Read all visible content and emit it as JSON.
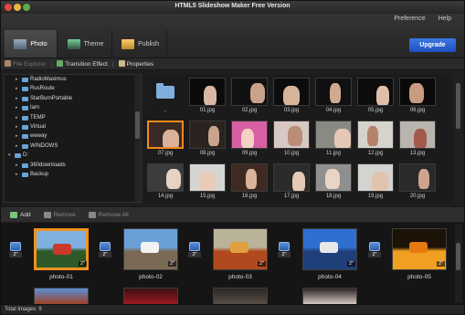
{
  "window": {
    "title": "HTML5 Slideshow Maker Free Version"
  },
  "menu": {
    "preference": "Preference",
    "help": "Help"
  },
  "tabs": [
    {
      "label": "Photo",
      "icon": "photo-tab-icon",
      "active": true
    },
    {
      "label": "Theme",
      "icon": "theme-tab-icon",
      "active": false
    },
    {
      "label": "Publish",
      "icon": "publish-tab-icon",
      "active": false
    }
  ],
  "upgrade_label": "Upgrade",
  "toolbar": {
    "file_explorer": "File Explorer",
    "transition_effect": "Transition Effect",
    "properties": "Properties",
    "separator": "|"
  },
  "tree": [
    {
      "label": "RadioMaximus",
      "level": 2,
      "expanded": false
    },
    {
      "label": "RusRoute",
      "level": 2,
      "expanded": false
    },
    {
      "label": "StarBurnPortable",
      "level": 2,
      "expanded": false
    },
    {
      "label": "tam",
      "level": 2,
      "expanded": false
    },
    {
      "label": "TEMP",
      "level": 2,
      "expanded": false
    },
    {
      "label": "Virtual",
      "level": 2,
      "expanded": false
    },
    {
      "label": "weway",
      "level": 2,
      "expanded": false
    },
    {
      "label": "WINDOWS",
      "level": 2,
      "expanded": false
    },
    {
      "label": "D:",
      "level": 1,
      "expanded": true
    },
    {
      "label": "360downloads",
      "level": 2,
      "expanded": false
    },
    {
      "label": "Backup",
      "level": 2,
      "expanded": false
    }
  ],
  "grid": {
    "items": [
      {
        "label": "..",
        "kind": "folder"
      },
      {
        "label": "01.jpg",
        "kind": "image",
        "bg": "#0b0b0b",
        "fg": "#d9b8a3"
      },
      {
        "label": "02.jpg",
        "kind": "image",
        "bg": "#111111",
        "fg": "#caa28a"
      },
      {
        "label": "03.jpg",
        "kind": "image",
        "bg": "#0c0c0c",
        "fg": "#d6b49a"
      },
      {
        "label": "04.jpg",
        "kind": "image",
        "bg": "#101010",
        "fg": "#cfa990"
      },
      {
        "label": "05.jpg",
        "kind": "image",
        "bg": "#0d0d0d",
        "fg": "#e0bfa8"
      },
      {
        "label": "06.jpg",
        "kind": "image",
        "bg": "#0a0a0a",
        "fg": "#c89c82"
      },
      {
        "label": "07.jpg",
        "kind": "image",
        "bg": "#3a2a26",
        "fg": "#d8b29a",
        "selected": true
      },
      {
        "label": "08.jpg",
        "kind": "image",
        "bg": "#2a2320",
        "fg": "#c9a38c"
      },
      {
        "label": "09.jpg",
        "kind": "image",
        "bg": "#d85fa4",
        "fg": "#f2d2c0"
      },
      {
        "label": "10.jpg",
        "kind": "image",
        "bg": "#d7c8c2",
        "fg": "#b98d78"
      },
      {
        "label": "11.jpg",
        "kind": "image",
        "bg": "#8a8a84",
        "fg": "#e4c7b4"
      },
      {
        "label": "12.jpg",
        "kind": "image",
        "bg": "#d6d2cc",
        "fg": "#b5826c"
      },
      {
        "label": "13.jpg",
        "kind": "image",
        "bg": "#b9b4ae",
        "fg": "#a45a4a"
      },
      {
        "label": "14.jpg",
        "kind": "image",
        "bg": "#3c3c3c",
        "fg": "#e8d2c2"
      },
      {
        "label": "15.jpg",
        "kind": "image",
        "bg": "#d5d5d2",
        "fg": "#e8ccb8"
      },
      {
        "label": "16.jpg",
        "kind": "image",
        "bg": "#3e2a22",
        "fg": "#d9b39b"
      },
      {
        "label": "17.jpg",
        "kind": "image",
        "bg": "#2b2b2b",
        "fg": "#e6c9b6"
      },
      {
        "label": "18.jpg",
        "kind": "image",
        "bg": "#8f8f8f",
        "fg": "#e9d4c6"
      },
      {
        "label": "19.jpg",
        "kind": "image",
        "bg": "#d3d3d0",
        "fg": "#e2c3ae"
      },
      {
        "label": "20.jpg",
        "kind": "image",
        "bg": "#2a2a2a",
        "fg": "#cfa48c"
      }
    ]
  },
  "actions": {
    "add": "Add",
    "remove": "Remove",
    "remove_all": "Remove All"
  },
  "storyboard": {
    "slides": [
      {
        "name": "photo-01",
        "duration": "2\"",
        "transition": "2\"",
        "top": "#7fb0e0",
        "bottom": "#2e5a2a",
        "accent": "#c93a2a",
        "selected": true
      },
      {
        "name": "photo-02",
        "duration": "2\"",
        "transition": "2\"",
        "top": "#6aa0d8",
        "bottom": "#7a6a55",
        "accent": "#f2f2f2"
      },
      {
        "name": "photo-03",
        "duration": "2\"",
        "transition": "2\"",
        "top": "#b9b39a",
        "bottom": "#b04a1e",
        "accent": "#e0a040"
      },
      {
        "name": "photo-04",
        "duration": "2\"",
        "transition": "2\"",
        "top": "#2f6fd0",
        "bottom": "#1f3f7a",
        "accent": "#e8e8e8"
      },
      {
        "name": "photo-05",
        "duration": "2\"",
        "transition": "",
        "top": "#1d1206",
        "bottom": "#f0a020",
        "accent": "#e87810"
      }
    ],
    "row2": [
      {
        "top": "#5a8fd6",
        "bottom": "#a33c1c"
      },
      {
        "top": "#3a1010",
        "bottom": "#a21a22"
      },
      {
        "top": "#2a2624",
        "bottom": "#5a5048"
      },
      {
        "top": "#2d2424",
        "bottom": "#e0d0c8"
      }
    ]
  },
  "status": {
    "total_images": "Total Images: 9"
  }
}
